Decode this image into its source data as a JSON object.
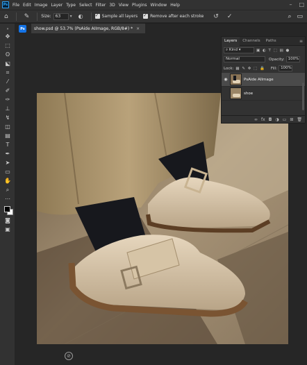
{
  "menubar": {
    "logo": "Ps",
    "items": [
      "File",
      "Edit",
      "Image",
      "Layer",
      "Type",
      "Select",
      "Filter",
      "3D",
      "View",
      "Plugins",
      "Window",
      "Help"
    ]
  },
  "options": {
    "size_label": "Size:",
    "size_value": "63",
    "sample_all_layers": "Sample all layers",
    "remove_after_stroke": "Remove after each stroke"
  },
  "document": {
    "tab_icon": "Ps",
    "tab_title": "show.psd @ 53.7% (PsAide AIImage, RGB/8#) *",
    "close": "×"
  },
  "layers_panel": {
    "tabs": [
      "Layers",
      "Channels",
      "Paths"
    ],
    "filter_kind": "Kind",
    "blend_mode": "Normal",
    "opacity_label": "Opacity:",
    "opacity_value": "100%",
    "lock_label": "Lock:",
    "fill_label": "Fill:",
    "fill_value": "100%",
    "layers": [
      {
        "name": "PsAide AIImage",
        "selected": true
      },
      {
        "name": "shoe",
        "selected": false
      }
    ]
  },
  "colors": {
    "accent": "#1473e6",
    "panel_bg": "#323232",
    "canvas_bg": "#262626"
  }
}
